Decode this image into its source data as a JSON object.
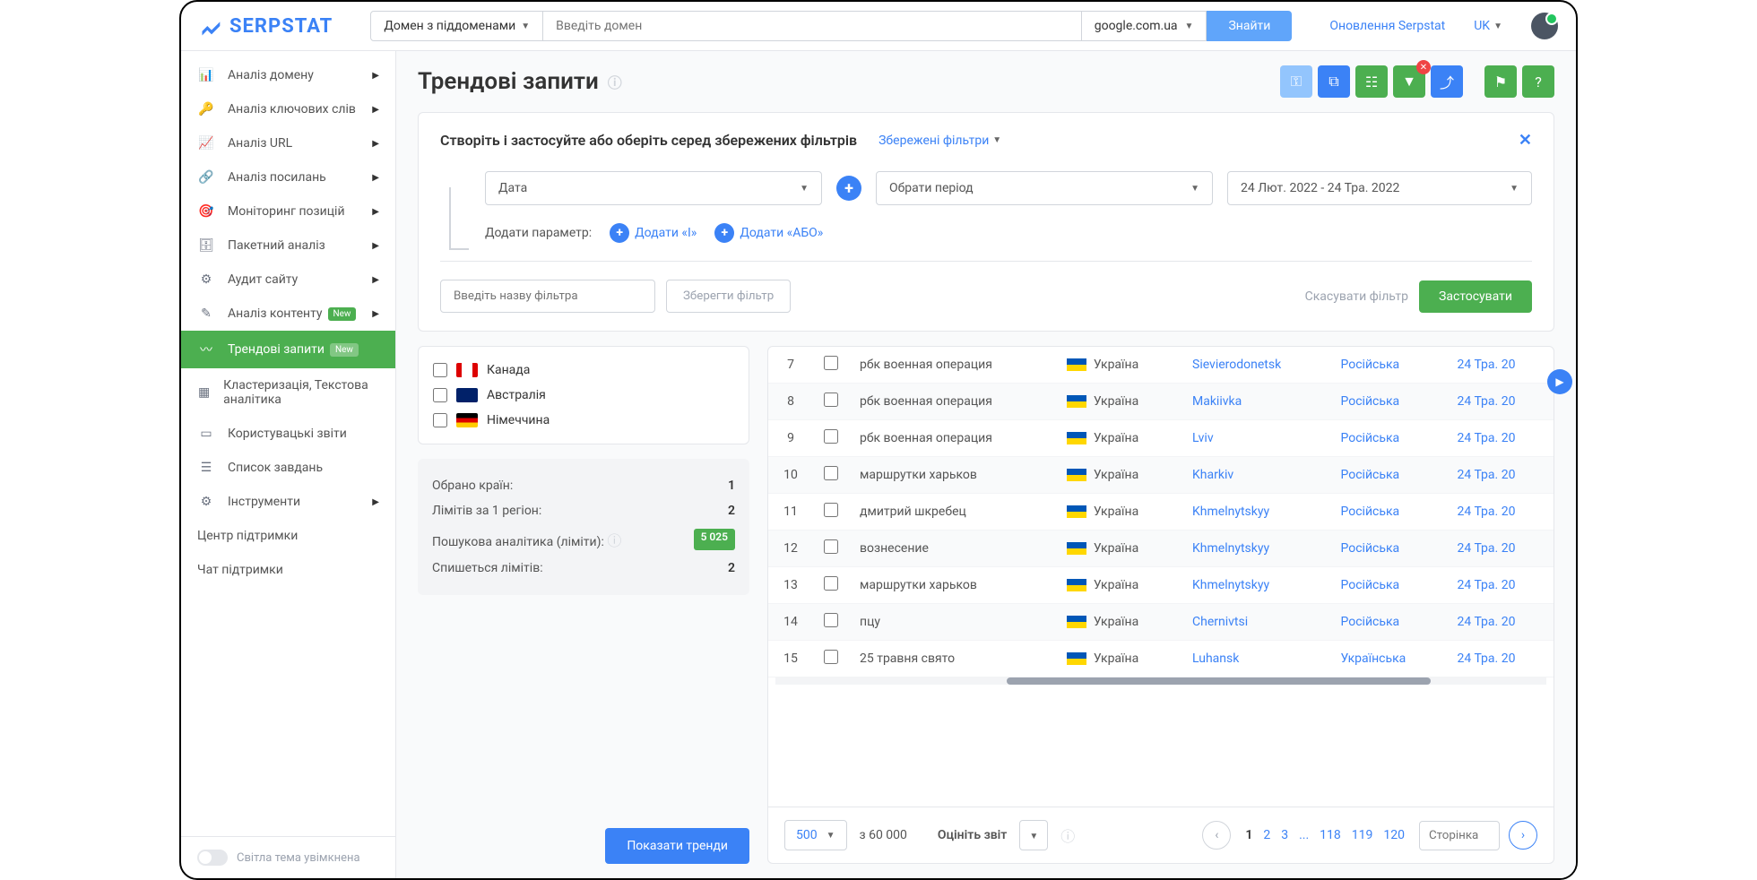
{
  "header": {
    "logo": "SERPSTAT",
    "domain_type": "Домен з піддоменами",
    "search_placeholder": "Введіть домен",
    "search_engine": "google.com.ua",
    "find_btn": "Знайти",
    "updates": "Оновлення Serpstat",
    "lang": "UK"
  },
  "sidebar": {
    "items": [
      {
        "label": "Аналіз домену",
        "icon": "📊"
      },
      {
        "label": "Аналіз ключових слів",
        "icon": "🔑"
      },
      {
        "label": "Аналіз URL",
        "icon": "📈"
      },
      {
        "label": "Аналіз посилань",
        "icon": "🔗"
      },
      {
        "label": "Моніторинг позицій",
        "icon": "🎯"
      },
      {
        "label": "Пакетний аналіз",
        "icon": "🗄"
      },
      {
        "label": "Аудит сайту",
        "icon": "⚙"
      },
      {
        "label": "Аналіз контенту",
        "icon": "✎",
        "badge": "New"
      },
      {
        "label": "Трендові запити",
        "icon": "〰",
        "badge": "New",
        "active": true
      },
      {
        "label": "Кластеризація, Текстова аналітика",
        "icon": "▦"
      },
      {
        "label": "Користувацькі звіти",
        "icon": "▭"
      },
      {
        "label": "Список завдань",
        "icon": "☰"
      },
      {
        "label": "Інструменти",
        "icon": "⚙"
      }
    ],
    "support": "Центр підтримки",
    "chat": "Чат підтримки",
    "theme": "Світла тема увімкнена"
  },
  "page": {
    "title": "Трендові запити"
  },
  "filter": {
    "title": "Створіть і застосуйте або оберіть серед збережених фільтрів",
    "saved": "Збережені фільтри",
    "date_label": "Дата",
    "period_label": "Обрати період",
    "date_range": "24 Лют. 2022 - 24 Тра. 2022",
    "add_param": "Додати параметр:",
    "add_and": "Додати «І»",
    "add_or": "Додати «АБО»",
    "name_placeholder": "Введіть назву фільтра",
    "save_btn": "Зберегти фільтр",
    "cancel": "Скасувати фільтр",
    "apply": "Застосувати"
  },
  "countries": [
    {
      "name": "Канада",
      "bg": "linear-gradient(90deg,#d00 25%,#fff 25%,#fff 75%,#d00 75%)"
    },
    {
      "name": "Австралія",
      "bg": "#012169"
    },
    {
      "name": "Німеччина",
      "bg": "linear-gradient(#000 33%,#d00 33%,#d00 66%,#fc0 66%)"
    }
  ],
  "stats": {
    "selected_label": "Обрано країн:",
    "selected_val": "1",
    "limits_region_label": "Лімітів за 1 регіон:",
    "limits_region_val": "2",
    "search_limits_label": "Пошукова аналітика (ліміти):",
    "search_limits_val": "5 025",
    "used_label": "Спишеться лімітів:",
    "used_val": "2",
    "show_trends": "Показати тренди"
  },
  "table": {
    "rows": [
      {
        "n": "7",
        "q": "рбк военная операция",
        "c": "Україна",
        "city": "Sievierodonetsk",
        "lang": "Російська",
        "date": "24 Тра. 20"
      },
      {
        "n": "8",
        "q": "рбк военная операция",
        "c": "Україна",
        "city": "Makiivka",
        "lang": "Російська",
        "date": "24 Тра. 20"
      },
      {
        "n": "9",
        "q": "рбк военная операция",
        "c": "Україна",
        "city": "Lviv",
        "lang": "Російська",
        "date": "24 Тра. 20"
      },
      {
        "n": "10",
        "q": "маршрутки харьков",
        "c": "Україна",
        "city": "Kharkiv",
        "lang": "Російська",
        "date": "24 Тра. 20"
      },
      {
        "n": "11",
        "q": "дмитрий шкребец",
        "c": "Україна",
        "city": "Khmelnytskyy",
        "lang": "Російська",
        "date": "24 Тра. 20"
      },
      {
        "n": "12",
        "q": "вознесение",
        "c": "Україна",
        "city": "Khmelnytskyy",
        "lang": "Російська",
        "date": "24 Тра. 20"
      },
      {
        "n": "13",
        "q": "маршрутки харьков",
        "c": "Україна",
        "city": "Khmelnytskyy",
        "lang": "Російська",
        "date": "24 Тра. 20"
      },
      {
        "n": "14",
        "q": "пцу",
        "c": "Україна",
        "city": "Chernivtsi",
        "lang": "Російська",
        "date": "24 Тра. 20"
      },
      {
        "n": "15",
        "q": "25 травня свято",
        "c": "Україна",
        "city": "Luhansk",
        "lang": "Українська",
        "date": "24 Тра. 20"
      }
    ]
  },
  "pager": {
    "per_page": "500",
    "total": "з 60 000",
    "rate": "Оцініть звіт",
    "pages": [
      "1",
      "2",
      "3",
      "...",
      "118",
      "119",
      "120"
    ],
    "page_placeholder": "Сторінка"
  }
}
